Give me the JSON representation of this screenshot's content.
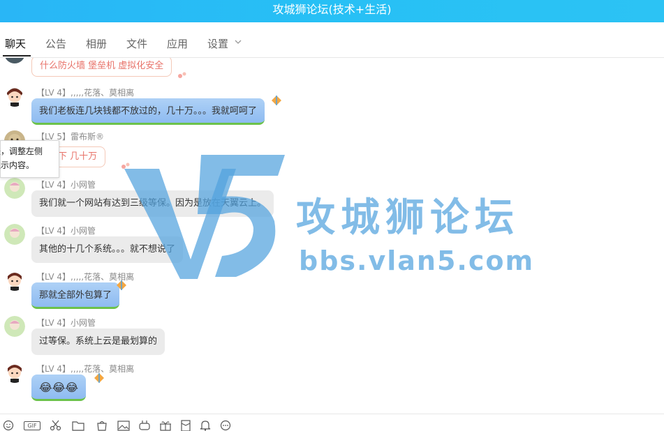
{
  "window": {
    "title": "攻城狮论坛(技术+生活)"
  },
  "tabs": [
    {
      "label": "聊天",
      "active": true
    },
    {
      "label": "公告"
    },
    {
      "label": "相册"
    },
    {
      "label": "文件"
    },
    {
      "label": "应用"
    },
    {
      "label": "设置"
    }
  ],
  "tooltip": {
    "line1": "是，调整左侧",
    "line2": "显示内容。"
  },
  "messages": [
    {
      "sender": "",
      "text": "什么防火墙  堡垒机  虚拟化安全",
      "style": "peach"
    },
    {
      "sender": "【LV 4】,,,,,花落、莫相离",
      "text": "我们老板连几块钱都不放过的，几十万。。。我就呵呵了",
      "style": "blue"
    },
    {
      "sender": "【LV 5】雷布斯®",
      "text": "搞一下  几十万",
      "style": "peach"
    },
    {
      "sender": "【LV 4】小网管",
      "text": "我们就一个网站有达到三级等保。因为是放在天翼云上。",
      "style": "gray"
    },
    {
      "sender": "【LV 4】小网管",
      "text": "其他的十几个系统。。。就不想说了",
      "style": "gray"
    },
    {
      "sender": "【LV 4】,,,,,花落、莫相离",
      "text": "那就全部外包算了",
      "style": "blue"
    },
    {
      "sender": "【LV 4】小网管",
      "text": "过等保。系统上云是最划算的",
      "style": "gray"
    },
    {
      "sender": "【LV 4】,,,,,花落、莫相离",
      "text": "😂😂😂",
      "style": "blue"
    }
  ],
  "watermark": {
    "title": "攻城狮论坛",
    "url": "bbs.vlan5.com"
  },
  "toolbar": {
    "icons": [
      "smiley-icon",
      "gif-icon",
      "scissors-icon",
      "folder-icon",
      "bag-icon",
      "image-icon",
      "gamepad-icon",
      "gift-icon",
      "red-packet-icon",
      "bell-icon",
      "more-icon"
    ],
    "gif_label": "GIF"
  },
  "colors": {
    "titlebar": "#29b6f6",
    "bubble_blue": "#9ec7f4",
    "bubble_gray": "#ebebeb",
    "peach_text": "#e8736a"
  }
}
